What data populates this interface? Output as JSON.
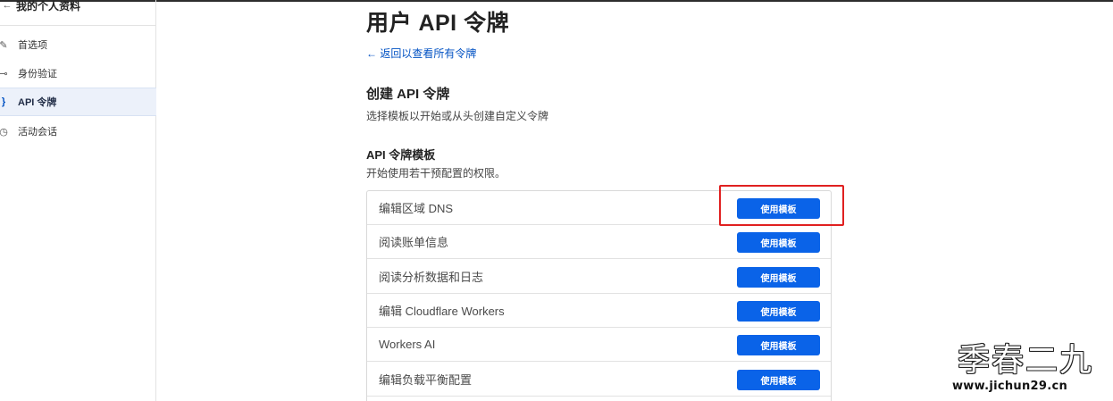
{
  "sidebar": {
    "header": {
      "back_icon": "arrow-left-icon",
      "title": "我的个人资料"
    },
    "items": [
      {
        "label": "首选项",
        "icon": "pencil-icon",
        "glyph": "✎",
        "active": false
      },
      {
        "label": "身份验证",
        "icon": "key-icon",
        "glyph": "⊸",
        "active": false
      },
      {
        "label": "API 令牌",
        "icon": "brace-icon",
        "glyph": "}",
        "active": true
      },
      {
        "label": "活动会话",
        "icon": "clock-icon",
        "glyph": "◷",
        "active": false
      }
    ]
  },
  "main": {
    "title": "用户 API 令牌",
    "back_link": "← 返回以查看所有令牌",
    "create_heading": "创建 API 令牌",
    "create_desc": "选择模板以开始或从头创建自定义令牌",
    "templates_heading": "API 令牌模板",
    "templates_desc": "开始使用若干预配置的权限。",
    "templates": [
      {
        "name": "编辑区域 DNS",
        "button": "使用模板"
      },
      {
        "name": "阅读账单信息",
        "button": "使用模板"
      },
      {
        "name": "阅读分析数据和日志",
        "button": "使用模板"
      },
      {
        "name": "编辑 Cloudflare Workers",
        "button": "使用模板"
      },
      {
        "name": "Workers AI",
        "button": "使用模板"
      },
      {
        "name": "编辑负载平衡配置",
        "button": "使用模板"
      }
    ]
  },
  "watermark": {
    "name": "季春二九",
    "url": "www.jichun29.cn"
  },
  "colors": {
    "accent": "#0a63e8",
    "link": "#0051c3",
    "highlight": "#e02020",
    "active_bg": "#ecf1fa"
  }
}
